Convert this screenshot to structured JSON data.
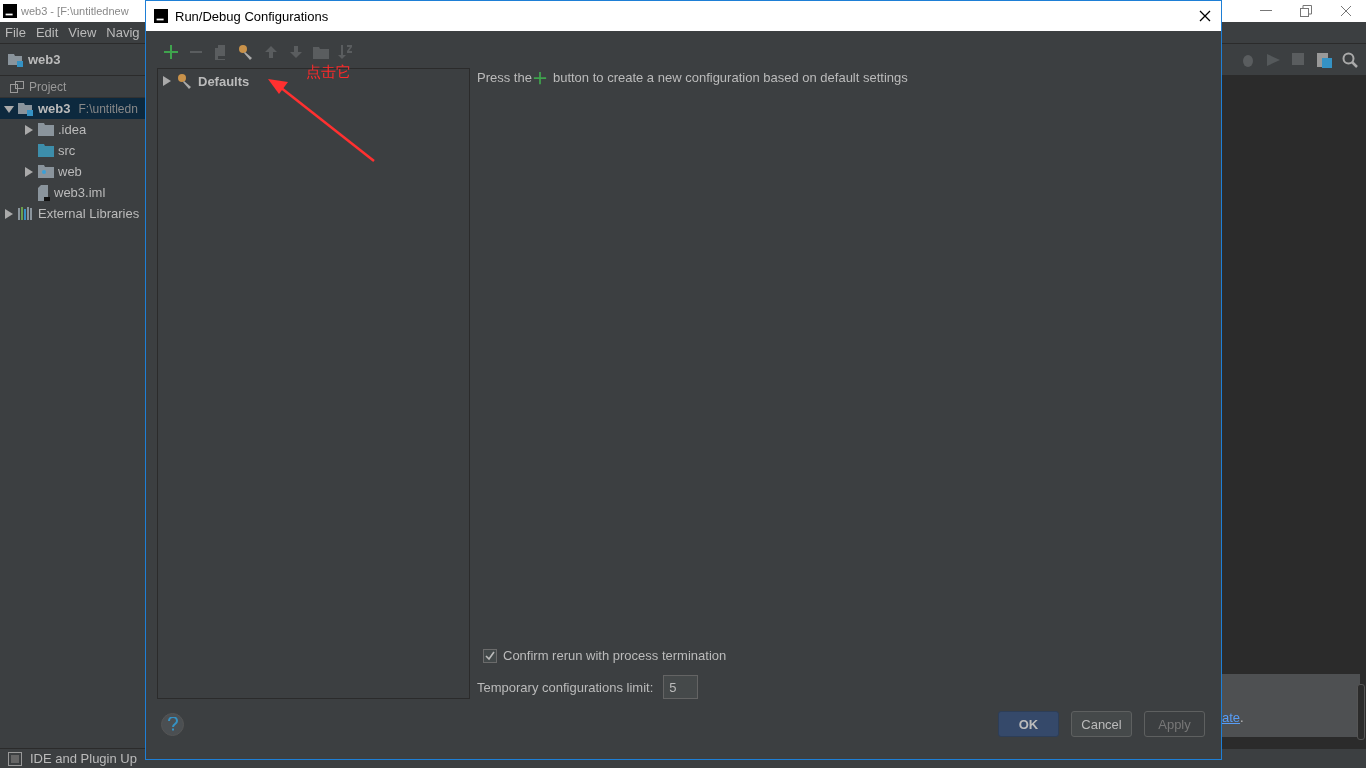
{
  "ide": {
    "title": "web3 - [F:\\untitlednew",
    "menu": [
      "File",
      "Edit",
      "View",
      "Navig"
    ],
    "breadcrumb": "web3",
    "project_tab": "Project",
    "tree": [
      {
        "label": "web3",
        "path": "F:\\untitledn",
        "kind": "module",
        "expanded": true,
        "selected": true,
        "children": [
          {
            "label": ".idea",
            "kind": "folder",
            "expanded": false,
            "selected": false
          },
          {
            "label": "src",
            "kind": "source",
            "selected": false
          },
          {
            "label": "web",
            "kind": "web",
            "expanded": false,
            "selected": false
          },
          {
            "label": "web3.iml",
            "kind": "file",
            "selected": false
          }
        ]
      },
      {
        "label": "External Libraries",
        "kind": "libraries",
        "expanded": false,
        "selected": false
      }
    ],
    "notification_link": "ate",
    "notification_tail": ".",
    "status": "IDE and Plugin Up"
  },
  "dialog": {
    "title": "Run/Debug Configurations",
    "toolbar": [
      {
        "kind": "add",
        "disabled": false
      },
      {
        "kind": "remove",
        "disabled": true
      },
      {
        "kind": "copy",
        "disabled": true
      },
      {
        "kind": "wrench",
        "disabled": false
      },
      {
        "kind": "up",
        "disabled": true
      },
      {
        "kind": "down",
        "disabled": true
      },
      {
        "kind": "folder",
        "disabled": true
      },
      {
        "kind": "sort",
        "disabled": true
      }
    ],
    "configs": [
      {
        "label": "Defaults",
        "expanded": false,
        "selected": false
      }
    ],
    "message_before": "Press the",
    "message_after": "button to create a new configuration based on default settings",
    "confirm": {
      "label": "Confirm rerun with process termination",
      "checked": true
    },
    "limit": {
      "label": "Temporary configurations limit:",
      "value": "5"
    },
    "buttons": [
      {
        "label": "OK",
        "kind": "default",
        "disabled": false
      },
      {
        "label": "Cancel",
        "kind": "normal",
        "disabled": false
      },
      {
        "label": "Apply",
        "kind": "normal",
        "disabled": true
      }
    ],
    "annotation": "点击它"
  }
}
